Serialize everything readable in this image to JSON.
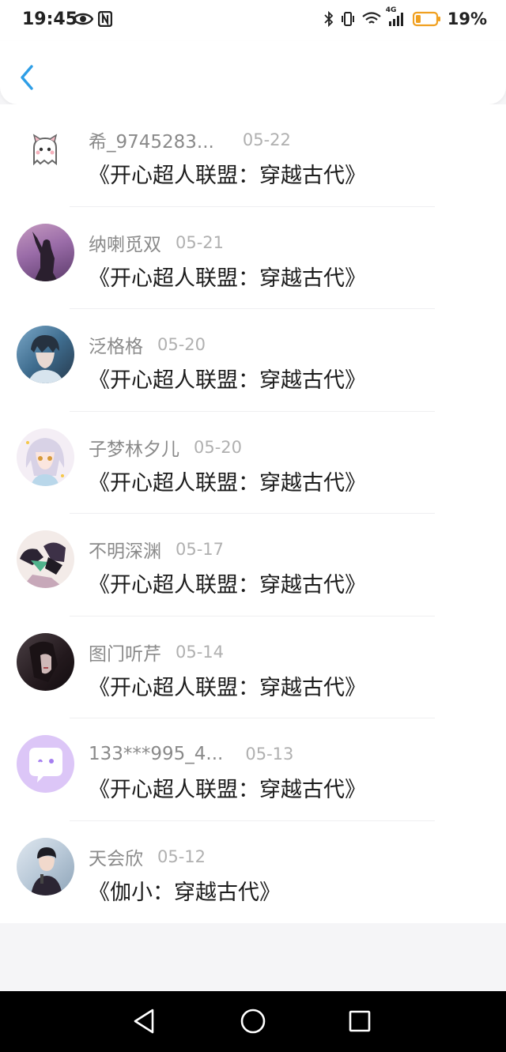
{
  "status_bar": {
    "time": "19:45",
    "battery_percent": "19%",
    "network_label": "4G",
    "left_icons": [
      "eye-icon",
      "nfc-icon"
    ],
    "right_icons": [
      "bluetooth-icon",
      "vibrate-icon",
      "wifi-icon",
      "signal-icon",
      "battery-icon"
    ]
  },
  "header": {
    "back_icon": "chevron-left-icon",
    "accent_color": "#2e9ee6"
  },
  "list": {
    "items": [
      {
        "username": "希_9745283...",
        "date": "05-22",
        "title": "《开心超人联盟：穿越古代》",
        "avatar": "ghost-cat-avatar"
      },
      {
        "username": "纳喇觅双",
        "date": "05-21",
        "title": "《开心超人联盟：穿越古代》",
        "avatar": "silhouette-avatar"
      },
      {
        "username": "泛格格",
        "date": "05-20",
        "title": "《开心超人联盟：穿越古代》",
        "avatar": "anime-boy-avatar"
      },
      {
        "username": "子梦林夕儿",
        "date": "05-20",
        "title": "《开心超人联盟：穿越古代》",
        "avatar": "anime-girl-avatar"
      },
      {
        "username": "不明深渊",
        "date": "05-17",
        "title": "《开心超人联盟：穿越古代》",
        "avatar": "anime-duo-avatar"
      },
      {
        "username": "图门听芹",
        "date": "05-14",
        "title": "《开心超人联盟：穿越古代》",
        "avatar": "dark-portrait-avatar"
      },
      {
        "username": "133***995_4...",
        "date": "05-13",
        "title": "《开心超人联盟：穿越古代》",
        "avatar": "chat-bubble-avatar"
      },
      {
        "username": "天会欣",
        "date": "05-12",
        "title": "《伽小：穿越古代》",
        "avatar": "photo-person-avatar"
      }
    ]
  },
  "nav_bar": {
    "icons": [
      "back-triangle-icon",
      "home-circle-icon",
      "recents-square-icon"
    ]
  }
}
